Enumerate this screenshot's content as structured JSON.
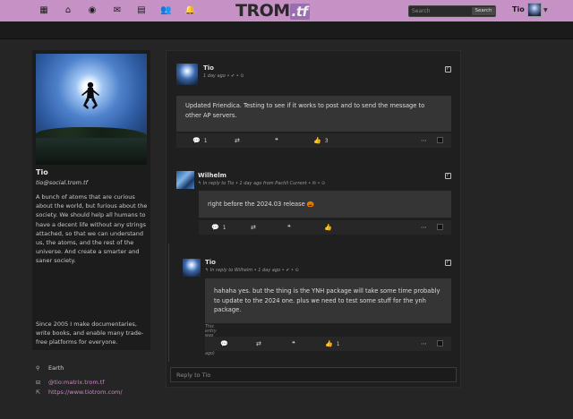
{
  "nav": {
    "icons": [
      "grid-icon",
      "home-icon",
      "community-icon",
      "mail-icon",
      "calendar-icon",
      "people-icon",
      "bell-icon"
    ],
    "logo_text": "TROM",
    "logo_tf": ".tf",
    "search_placeholder": "Search",
    "search_button": "Search",
    "user_name": "Tio"
  },
  "profile": {
    "name": "Tio",
    "handle": "tio@social.trom.tf",
    "bio": "A bunch of atoms that are curious about the world, but furious about the society. We should help all humans to have a decent life without any strings attached, so that we can understand us, the atoms, and the rest of the universe. And create a smarter and saner society.",
    "bio2": "Since 2005 I make documentaries, write books, and enable many trade-free platforms for everyone.",
    "location": "Earth",
    "matrix": "@tio:matrix.trom.tf",
    "website": "https://www.tiotrom.com/"
  },
  "posts": [
    {
      "author": "Tio",
      "meta": "1 day ago • ✔ • ⊙",
      "body": "Updated Friendica. Testing to see if it works to post and to send the message to other AP servers.",
      "comments": "1",
      "likes": "3"
    },
    {
      "author": "Wilhelm",
      "meta": "↰ In reply to Tio • 1 day ago from Pachli Current • ✉ • ⊙",
      "body": "right before the 2024.03 release 🎃",
      "comments": "1"
    },
    {
      "author": "Tio",
      "meta": "↰ In reply to Wilhelm • 1 day ago • ✔ • ⊙",
      "body": "hahaha yes. but the thing is the YNH package will take some time probably to update to the 2024 one. plus we need to test some stuff for the ynh package.",
      "edited": "This entry was edited (1 day ago)",
      "likes": "1"
    }
  ],
  "reply_placeholder": "Reply to Tio"
}
